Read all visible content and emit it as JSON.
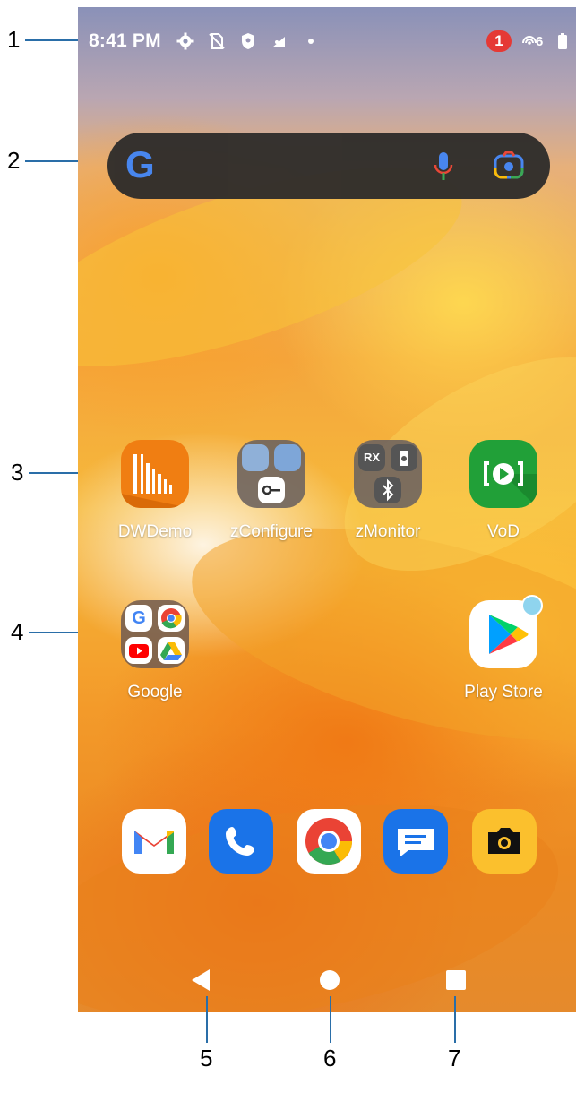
{
  "status_bar": {
    "time": "8:41 PM",
    "icons": [
      "gear-icon",
      "no-sim-icon",
      "shield-icon",
      "signal-icon",
      "dot-icon"
    ],
    "notification_count": "1",
    "hotspot_label": "6",
    "battery_icon": "battery-icon"
  },
  "search_bar": {
    "logo": "G",
    "icons": [
      "google-logo-icon",
      "microphone-icon",
      "lens-camera-icon"
    ]
  },
  "apps": [
    {
      "label": "DWDemo",
      "icon": "dwdemo-icon"
    },
    {
      "label": "zConfigure",
      "icon": "zconfigure-folder-icon"
    },
    {
      "label": "zMonitor",
      "icon": "zmonitor-folder-icon"
    },
    {
      "label": "VoD",
      "icon": "vod-icon"
    },
    {
      "label": "Google",
      "icon": "google-folder-icon"
    },
    {
      "label": "Play Store",
      "icon": "play-store-icon"
    }
  ],
  "zmonitor_rx": "RX",
  "dock": [
    "gmail-icon",
    "phone-icon",
    "chrome-icon",
    "messages-icon",
    "camera-icon"
  ],
  "nav": [
    "back-icon",
    "home-icon",
    "recents-icon"
  ],
  "callouts": [
    "1",
    "2",
    "3",
    "4",
    "5",
    "6",
    "7"
  ],
  "colors": {
    "accent_red": "#e53935",
    "callout_line": "#2a6ea8"
  }
}
